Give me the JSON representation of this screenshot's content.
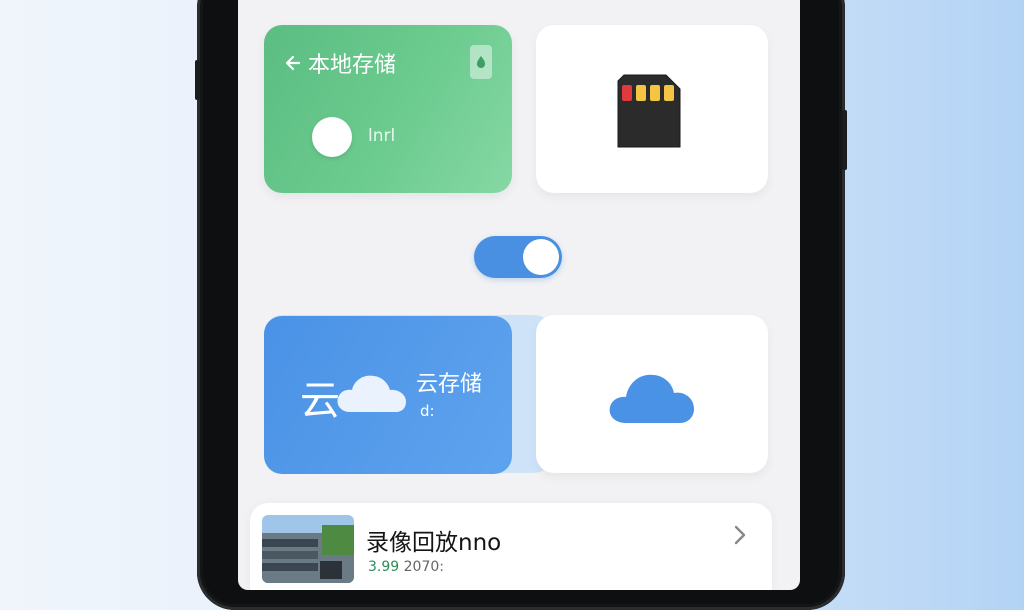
{
  "local_storage": {
    "title": "本地存储",
    "subtitle": "lnrl"
  },
  "cloud_storage": {
    "title": "云存储",
    "glyph": "云",
    "subtitle": "d:"
  },
  "toggle": {
    "on": true
  },
  "playback": {
    "title": "录像回放nno",
    "meta_prefix": "3.99",
    "meta_suffix": "2070:"
  },
  "colors": {
    "local_green": "#5bbd82",
    "cloud_blue": "#4a90e2",
    "background": "#f2f2f4"
  },
  "icons": [
    "back-arrow-icon",
    "sim-chip-icon",
    "sd-card-icon",
    "cloud-icon",
    "chevron-right-icon"
  ]
}
